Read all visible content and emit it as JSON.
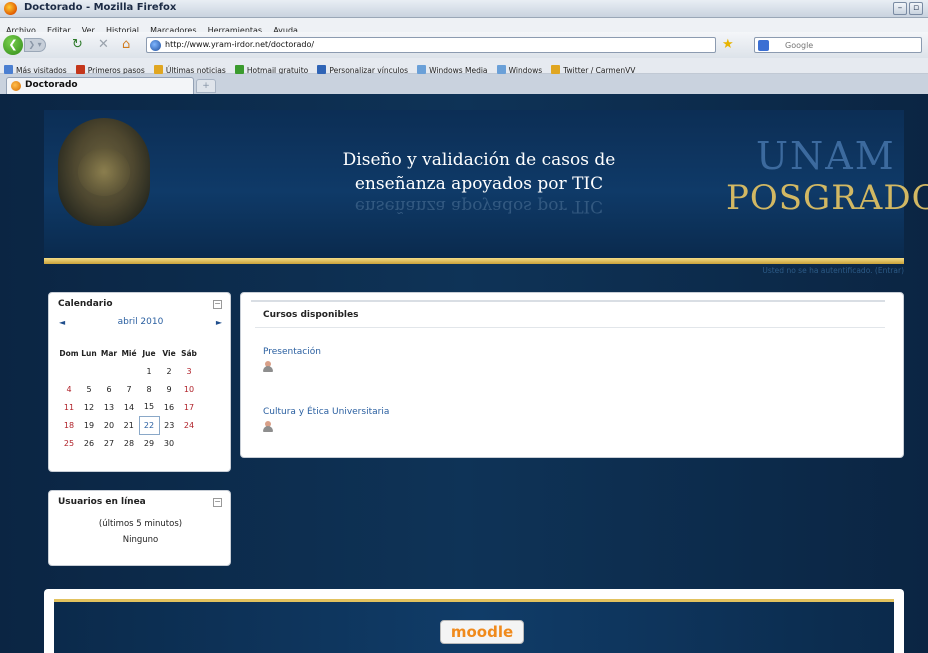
{
  "window": {
    "title": "Doctorado - Mozilla Firefox",
    "minimize": "–",
    "maximize": "▫"
  },
  "menu": [
    "Archivo",
    "Editar",
    "Ver",
    "Historial",
    "Marcadores",
    "Herramientas",
    "Ayuda"
  ],
  "nav": {
    "url": "http://www.yram-irdor.net/doctorado/",
    "search_placeholder": "Google"
  },
  "bookmarks": [
    {
      "label": "Más visitados",
      "color": "#4b7fd1"
    },
    {
      "label": "Primeros pasos",
      "color": "#c4361b"
    },
    {
      "label": "Últimas noticias",
      "color": "#e0a621"
    },
    {
      "label": "Hotmail gratuito",
      "color": "#3a9b2e"
    },
    {
      "label": "Personalizar vínculos",
      "color": "#2f64b6"
    },
    {
      "label": "Windows Media",
      "color": "#6aa0d8"
    },
    {
      "label": "Windows",
      "color": "#6aa0d8"
    },
    {
      "label": "Twitter / CarmenVV",
      "color": "#e0a621"
    }
  ],
  "tab": {
    "label": "Doctorado"
  },
  "header": {
    "title_line1": "Diseño y validación de casos de",
    "title_line2": "enseñanza apoyados por TIC",
    "logo_top": "UNAM",
    "logo_bottom": "POSGRADO"
  },
  "login": {
    "text": "Usted no se ha autentificado.",
    "link": "Entrar"
  },
  "calendar": {
    "title": "Calendario",
    "month": "abril 2010",
    "weekdays": [
      "Dom",
      "Lun",
      "Mar",
      "Mié",
      "Jue",
      "Vie",
      "Sáb"
    ],
    "weeks": [
      [
        "",
        "",
        "",
        "",
        "1",
        "2",
        "3"
      ],
      [
        "4",
        "5",
        "6",
        "7",
        "8",
        "9",
        "10"
      ],
      [
        "11",
        "12",
        "13",
        "14",
        "15",
        "16",
        "17"
      ],
      [
        "18",
        "19",
        "20",
        "21",
        "22",
        "23",
        "24"
      ],
      [
        "25",
        "26",
        "27",
        "28",
        "29",
        "30",
        ""
      ]
    ],
    "today": "22"
  },
  "online_users": {
    "title": "Usuarios en línea",
    "period": "(últimos 5 minutos)",
    "none": "Ninguno"
  },
  "courses": {
    "title": "Cursos disponibles",
    "items": [
      {
        "name": "Presentación"
      },
      {
        "name": "Cultura y Ética Universitaria"
      }
    ]
  },
  "footer": {
    "logo_text": "moodle"
  }
}
